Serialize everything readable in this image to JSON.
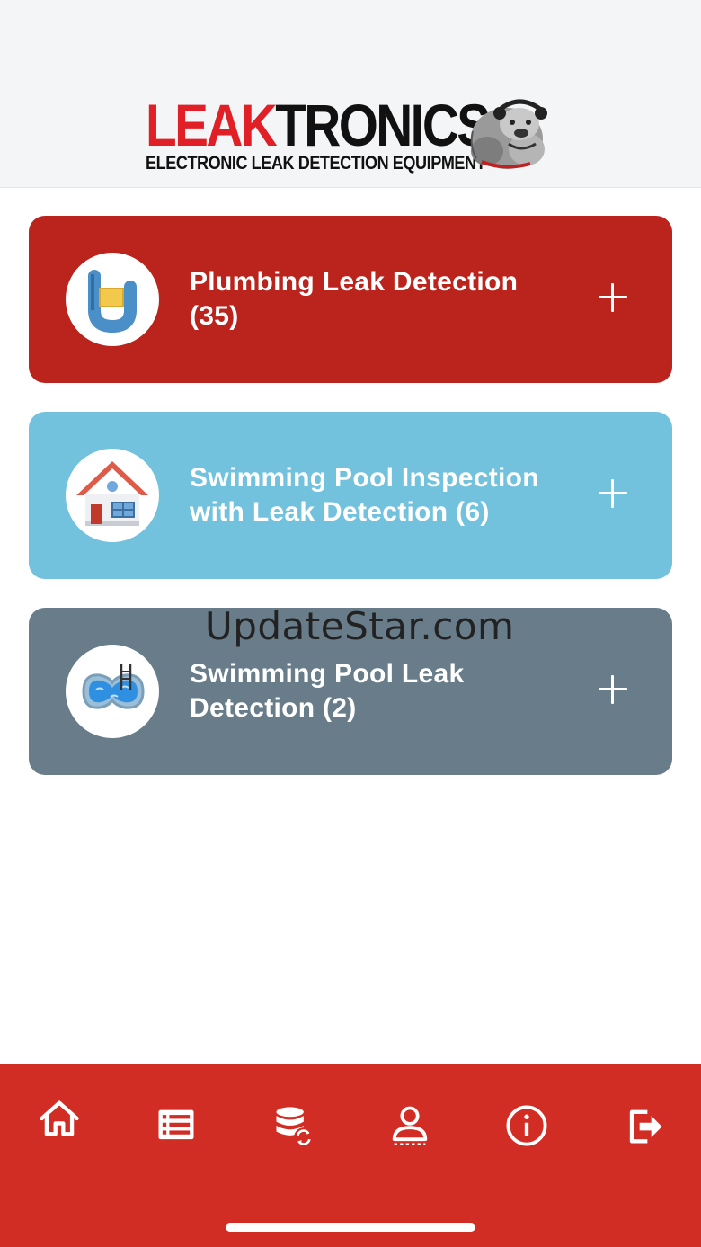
{
  "header": {
    "logo": {
      "brand_part1": "LEAK",
      "brand_part2": "TRONICS",
      "tagline": "ELECTRONIC LEAK DETECTION EQUIPMENT",
      "mascot_icon": "bulldog-mascot-icon"
    }
  },
  "categories": [
    {
      "label": "Plumbing Leak Detection (35)",
      "icon": "pipe-icon",
      "color": "#ba241d",
      "action_icon": "plus-icon"
    },
    {
      "label": "Swimming Pool Inspection with Leak Detection (6)",
      "icon": "house-icon",
      "color": "#72c2de",
      "action_icon": "plus-icon"
    },
    {
      "label": "Swimming Pool Leak Detection (2)",
      "icon": "pool-icon",
      "color": "#687d89",
      "action_icon": "plus-icon"
    }
  ],
  "watermark": "UpdateStar.com",
  "tabbar": {
    "color": "#d22d25",
    "items": [
      {
        "icon": "home-icon"
      },
      {
        "icon": "list-icon"
      },
      {
        "icon": "database-sync-icon"
      },
      {
        "icon": "user-icon"
      },
      {
        "icon": "info-icon"
      },
      {
        "icon": "logout-icon"
      }
    ]
  }
}
